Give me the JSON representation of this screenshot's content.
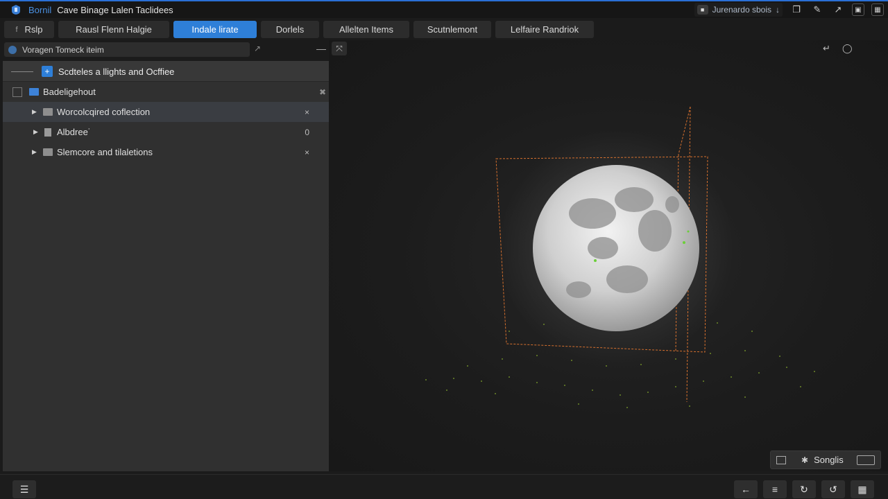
{
  "titlebar": {
    "app_name": "Bornil",
    "doc_title": "Cave Binage Lalen Taclidees",
    "status_label": "Jurenardo sbois",
    "status_chip": "■"
  },
  "tabs": [
    {
      "prefix": "f",
      "label": "Rslp"
    },
    {
      "label": "Rausl Flenn Halgie"
    },
    {
      "label": "Indale lirate",
      "active": true
    },
    {
      "label": "Dorlels"
    },
    {
      "label": "Allelten Items"
    },
    {
      "label": "Scutnlemont"
    },
    {
      "label": "Lelfaire Randriok"
    }
  ],
  "left": {
    "search_value": "Voragen Tomeck iteim",
    "tree_header": "Scdteles  a llights and Ocffiee",
    "rows": [
      {
        "label": "Badeligehout",
        "close": "✖"
      },
      {
        "label": "Worcolcqired coflection",
        "close": "×",
        "selected": true
      },
      {
        "label": "Albdree˙",
        "close": "0"
      },
      {
        "label": "Slemcore and tilaletions",
        "close": "×"
      }
    ]
  },
  "viewport": {
    "settings_label": "Songlis"
  }
}
